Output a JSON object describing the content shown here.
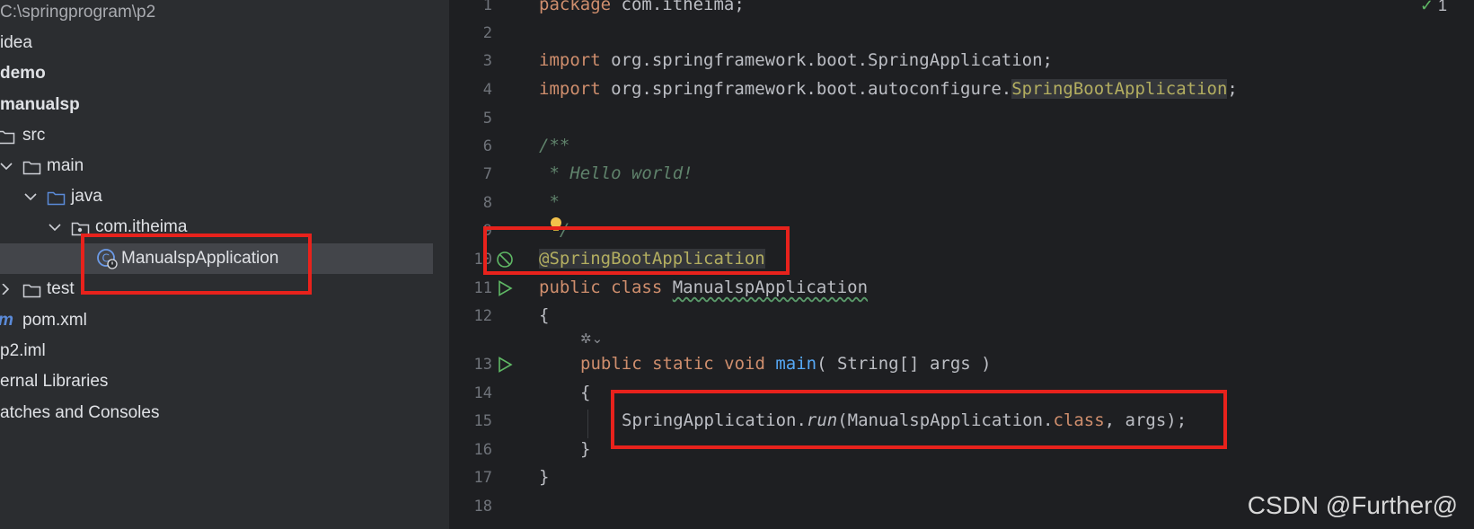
{
  "project_tree": {
    "items": [
      {
        "label": "C:\\springprogram\\p2"
      },
      {
        "label": "idea"
      },
      {
        "label": "demo"
      },
      {
        "label": "manualsp"
      },
      {
        "label": "src"
      },
      {
        "label": "main"
      },
      {
        "label": "java"
      },
      {
        "label": "com.itheima"
      },
      {
        "label": "ManualspApplication"
      },
      {
        "label": "test"
      },
      {
        "label": "pom.xml",
        "prefix": "m"
      },
      {
        "label": "p2.iml"
      },
      {
        "label": "ernal Libraries"
      },
      {
        "label": "atches and Consoles"
      }
    ]
  },
  "editor": {
    "line_numbers": [
      "1",
      "2",
      "3",
      "4",
      "5",
      "6",
      "7",
      "8",
      "9",
      "10",
      "11",
      "12",
      "13",
      "14",
      "15",
      "16",
      "17",
      "18"
    ],
    "inspection_count": "1",
    "code": {
      "l1_kw": "package",
      "l1_rest": " com.itheima;",
      "l3_kw": "import",
      "l3_rest": " org.springframework.boot.SpringApplication;",
      "l4_kw": "import",
      "l4_pkg": " org.springframework.boot.autoconfigure.",
      "l4_cls": "SpringBootApplication",
      "l4_end": ";",
      "l6": "/**",
      "l7": " * Hello world!",
      "l8": " *",
      "l9": " */",
      "l10": "@SpringBootApplication",
      "l11_kw": "public class ",
      "l11_cls": "ManualspApplication",
      "l12": "{",
      "l13_kw": "public static void ",
      "l13_fn": "main",
      "l13_rest": "( String[] args )",
      "l14": "{",
      "l15_a": "SpringApplication.",
      "l15_run": "run",
      "l15_b": "(ManualspApplication.",
      "l15_kw": "class",
      "l15_c": ", args);",
      "l16": "}",
      "l17": "}"
    }
  },
  "watermark": "CSDN @Further@",
  "colors": {
    "annotation_box": "#e8221c",
    "keyword": "#cf8e6d",
    "annotation": "#b3ae60",
    "comment": "#5f826b"
  }
}
